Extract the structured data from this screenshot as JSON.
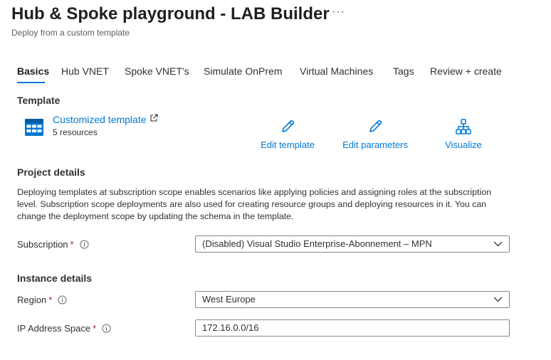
{
  "header": {
    "title": "Hub & Spoke playground - LAB Builder",
    "more_label": "···",
    "subtitle": "Deploy from a custom template"
  },
  "tabs": [
    {
      "label": "Basics",
      "active": true
    },
    {
      "label": "Hub VNET"
    },
    {
      "label": "Spoke VNET's"
    },
    {
      "label": "Simulate OnPrem"
    },
    {
      "label": "Virtual Machines"
    },
    {
      "label": "Tags"
    },
    {
      "label": "Review + create"
    }
  ],
  "template": {
    "heading": "Template",
    "link_label": "Customized template",
    "resources": "5 resources",
    "actions": {
      "edit_template": "Edit template",
      "edit_parameters": "Edit parameters",
      "visualize": "Visualize"
    }
  },
  "project": {
    "heading": "Project details",
    "description": "Deploying templates at subscription scope enables scenarios like applying policies and assigning roles at the subscription level. Subscription scope deployments are also used for creating resource groups and deploying resources in it. You can change the deployment scope by updating the schema in the template.",
    "subscription_label": "Subscription",
    "subscription_value": "(Disabled) Visual Studio Enterprise-Abonnement – MPN"
  },
  "instance": {
    "heading": "Instance details",
    "region_label": "Region",
    "region_value": "West Europe",
    "ip_label": "IP Address Space",
    "ip_value": "172.16.0.0/16"
  },
  "required_marker": "*",
  "colors": {
    "accent": "#0078d4",
    "required": "#a4262c",
    "text": "#323130",
    "border": "#8a8886"
  },
  "icons": [
    "more-icon",
    "template-grid-icon",
    "external-link-icon",
    "pencil-icon",
    "hierarchy-icon",
    "info-icon",
    "chevron-down-icon"
  ]
}
